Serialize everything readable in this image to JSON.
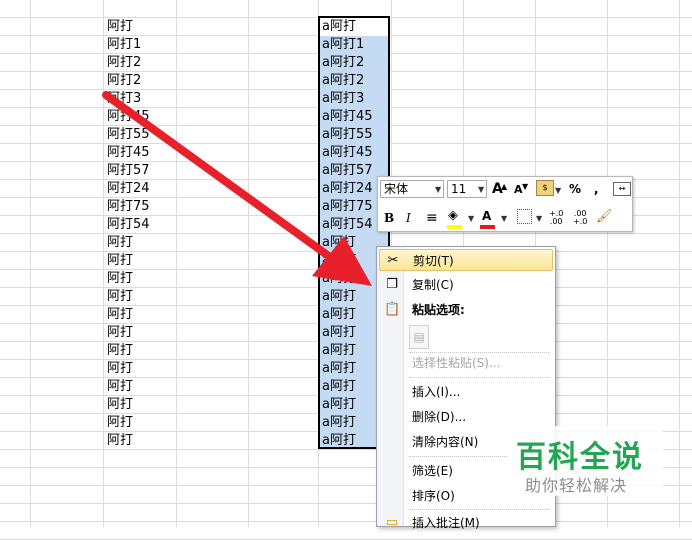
{
  "sheet": {
    "column_a": [
      "阿打",
      "阿打1",
      "阿打2",
      "阿打2",
      "阿打3",
      "阿打45",
      "阿打55",
      "阿打45",
      "阿打57",
      "阿打24",
      "阿打75",
      "阿打54",
      "阿打",
      "阿打",
      "阿打",
      "阿打",
      "阿打",
      "阿打",
      "阿打",
      "阿打",
      "阿打",
      "阿打",
      "阿打",
      "阿打"
    ],
    "column_e": [
      "a阿打",
      "a阿打1",
      "a阿打2",
      "a阿打2",
      "a阿打3",
      "a阿打45",
      "a阿打55",
      "a阿打45",
      "a阿打57",
      "a阿打24",
      "a阿打75",
      "a阿打54",
      "a阿打",
      "a阿打",
      "a阿打",
      "a阿打",
      "a阿打",
      "a阿打",
      "a阿打",
      "a阿打",
      "a阿打",
      "a阿打",
      "a阿打",
      "a阿打"
    ],
    "selection_color": "#c5dbf3"
  },
  "mini_toolbar": {
    "font_name": "宋体",
    "font_size": "11",
    "grow_font": "A",
    "shrink_font": "A",
    "percent": "%",
    "comma": ",",
    "bold": "B",
    "italic": "I",
    "font_color_letter": "A",
    "inc_decimal": "+.0\n.00",
    "dec_decimal": ".00\n+.0",
    "font_color": "#e02020",
    "fill_color": "#ffff00"
  },
  "context_menu": {
    "cut": "剪切(T)",
    "copy": "复制(C)",
    "paste_options": "粘贴选项:",
    "paste_special": "选择性粘贴(S)...",
    "insert": "插入(I)...",
    "delete": "删除(D)...",
    "clear_contents": "清除内容(N)",
    "filter": "筛选(E)",
    "sort": "排序(O)",
    "insert_comment": "插入批注(M)"
  },
  "watermark": {
    "title": "百科全说",
    "subtitle": "助你轻松解决",
    "color": "#23a651"
  },
  "annotation": {
    "arrow_color": "#e8202a"
  }
}
